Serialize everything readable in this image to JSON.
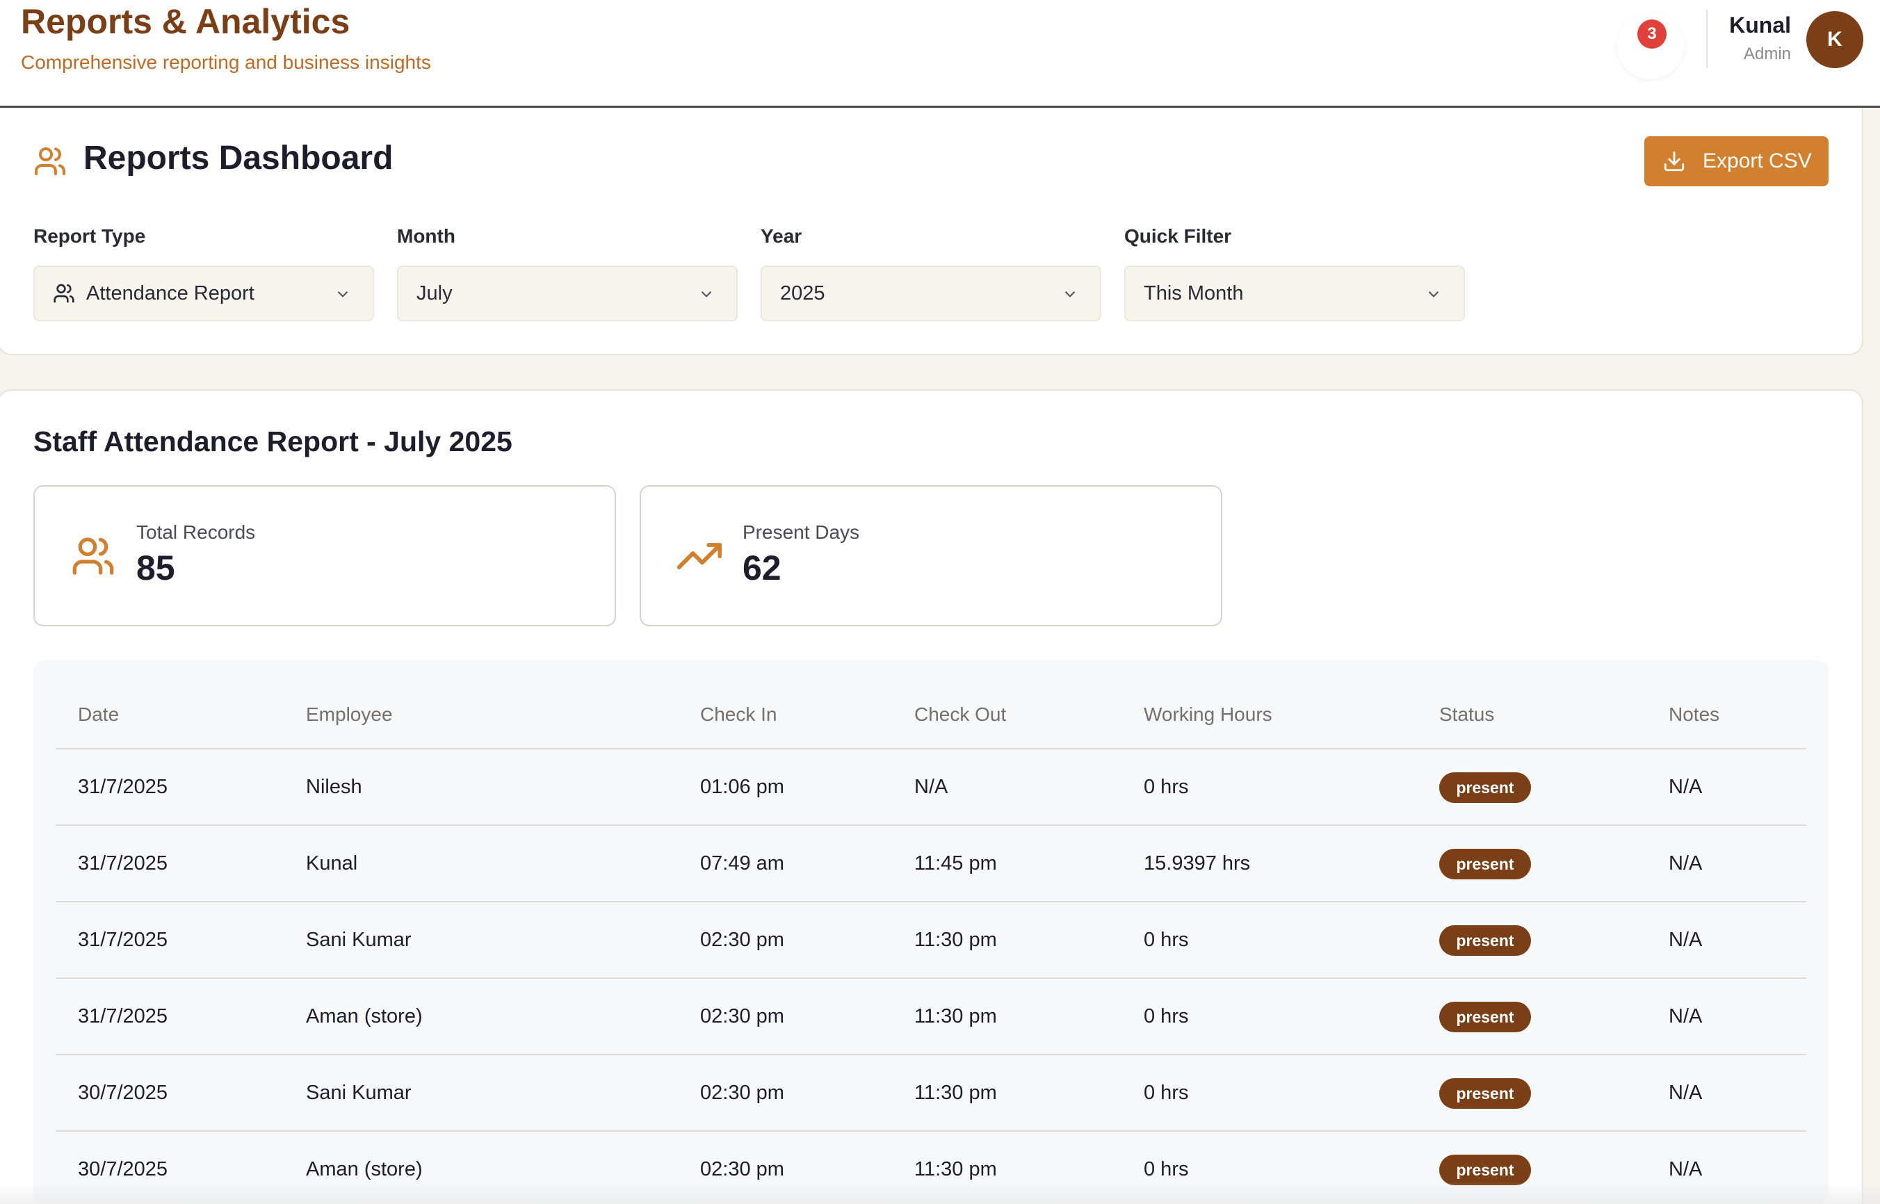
{
  "header": {
    "title": "Reports & Analytics",
    "subtitle": "Comprehensive reporting and business insights",
    "notification_count": "3",
    "user_name": "Kunal",
    "user_role": "Admin",
    "avatar_initial": "K"
  },
  "dashboard": {
    "title": "Reports Dashboard",
    "export_label": "Export CSV",
    "filters": [
      {
        "label": "Report Type",
        "value": "Attendance Report"
      },
      {
        "label": "Month",
        "value": "July"
      },
      {
        "label": "Year",
        "value": "2025"
      },
      {
        "label": "Quick Filter",
        "value": "This Month"
      }
    ]
  },
  "report": {
    "title": "Staff Attendance Report - July 2025",
    "stats": [
      {
        "label": "Total Records",
        "value": "85",
        "icon": "users-icon"
      },
      {
        "label": "Present Days",
        "value": "62",
        "icon": "trending-up-icon"
      }
    ],
    "columns": [
      "Date",
      "Employee",
      "Check In",
      "Check Out",
      "Working Hours",
      "Status",
      "Notes"
    ],
    "rows": [
      {
        "date": "31/7/2025",
        "employee": "Nilesh",
        "check_in": "01:06 pm",
        "check_out": "N/A",
        "hours": "0 hrs",
        "status": "present",
        "notes": "N/A"
      },
      {
        "date": "31/7/2025",
        "employee": "Kunal",
        "check_in": "07:49 am",
        "check_out": "11:45 pm",
        "hours": "15.9397 hrs",
        "status": "present",
        "notes": "N/A"
      },
      {
        "date": "31/7/2025",
        "employee": "Sani Kumar",
        "check_in": "02:30 pm",
        "check_out": "11:30 pm",
        "hours": "0 hrs",
        "status": "present",
        "notes": "N/A"
      },
      {
        "date": "31/7/2025",
        "employee": "Aman (store)",
        "check_in": "02:30 pm",
        "check_out": "11:30 pm",
        "hours": "0 hrs",
        "status": "present",
        "notes": "N/A"
      },
      {
        "date": "30/7/2025",
        "employee": "Sani Kumar",
        "check_in": "02:30 pm",
        "check_out": "11:30 pm",
        "hours": "0 hrs",
        "status": "present",
        "notes": "N/A"
      },
      {
        "date": "30/7/2025",
        "employee": "Aman (store)",
        "check_in": "02:30 pm",
        "check_out": "11:30 pm",
        "hours": "0 hrs",
        "status": "present",
        "notes": "N/A"
      }
    ]
  },
  "colors": {
    "brand": "#7b3f17",
    "accent": "#d0802e",
    "badge": "#e0413a"
  }
}
